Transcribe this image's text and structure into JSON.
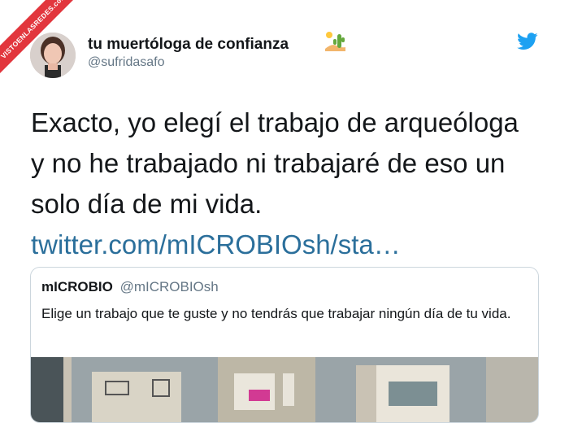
{
  "watermark": {
    "text": "VISTOENLASREDES",
    "subtext": ".com"
  },
  "author": {
    "display_name": "tu muertóloga de confianza",
    "name_emoji": "desert-cactus-emoji",
    "handle": "@sufridasafo",
    "avatar": "profile-photo"
  },
  "platform_icon": "twitter-bird-icon",
  "tweet": {
    "text_lines": [
      "Exacto, yo elegí el trabajo de arqueóloga",
      "y no he trabajado ni trabajaré de eso un",
      "solo día de mi vida."
    ],
    "link": "twitter.com/mICROBIOsh/sta…"
  },
  "quoted_tweet": {
    "display_name": "mICROBIO",
    "handle": "@mICROBIOsh",
    "text": "Elige un trabajo que te guste y no tendrás que trabajar ningún día de tu vida."
  },
  "colors": {
    "link": "#2b6f9b",
    "twitter_blue": "#1da1f2",
    "handle_gray": "#657786",
    "ribbon_red": "#e2363d"
  }
}
